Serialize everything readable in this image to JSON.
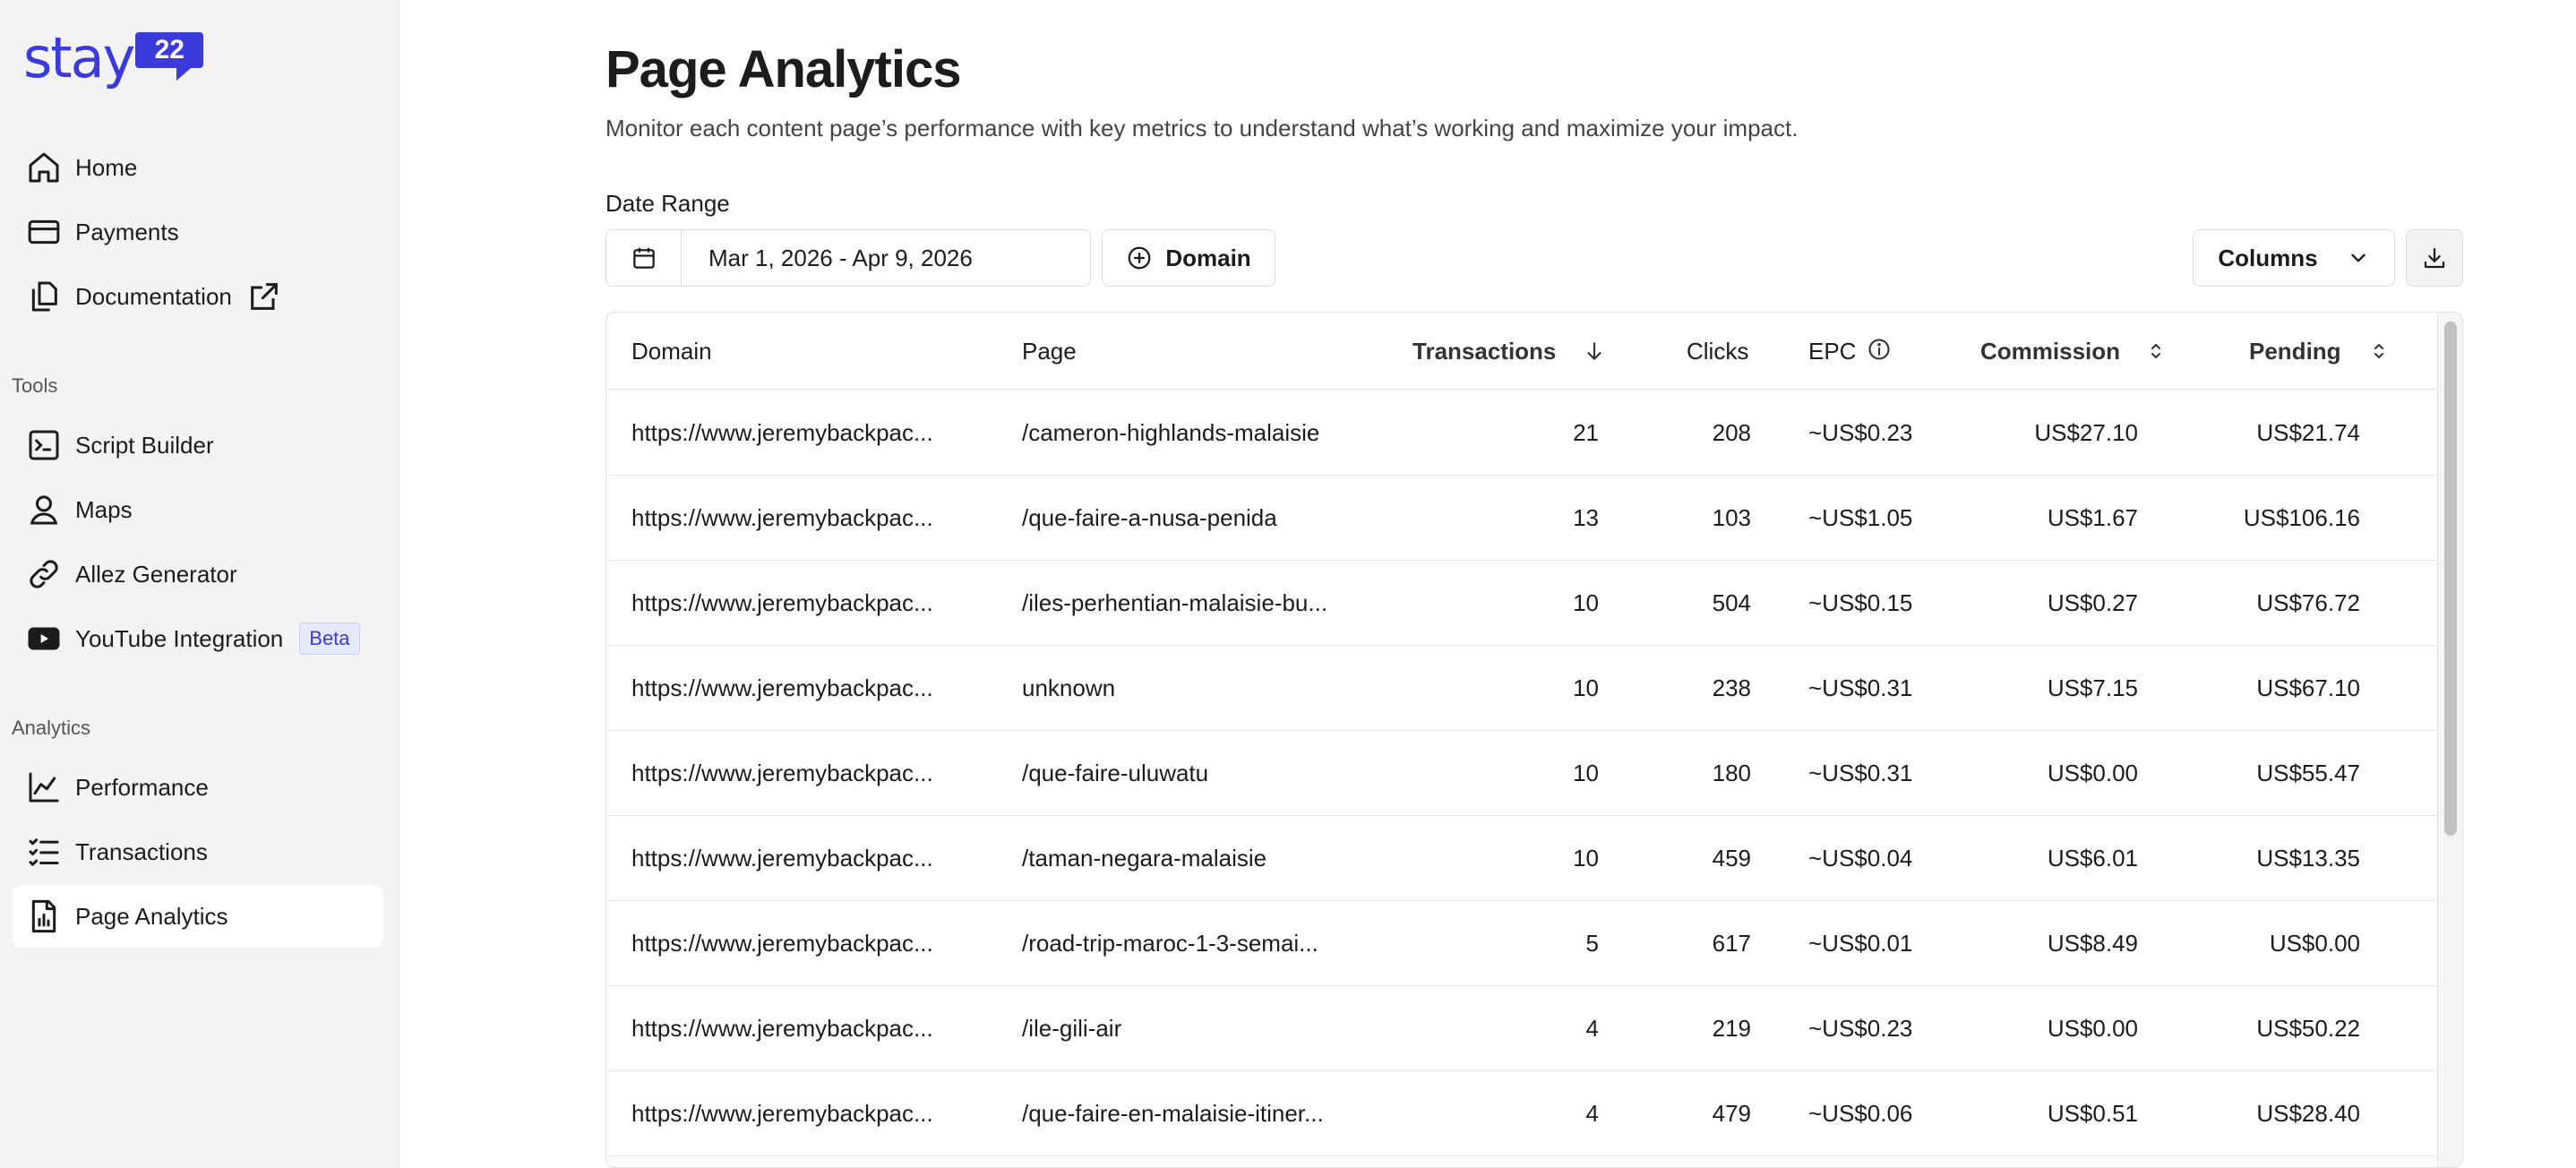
{
  "brand": {
    "name": "stay",
    "badge": "22",
    "color": "#3b3bdc"
  },
  "nav": {
    "main": [
      {
        "label": "Home",
        "icon": "home-icon"
      },
      {
        "label": "Payments",
        "icon": "credit-card-icon"
      },
      {
        "label": "Documentation",
        "icon": "copy-icon",
        "external": true
      }
    ],
    "tools_label": "Tools",
    "tools": [
      {
        "label": "Script Builder",
        "icon": "terminal-icon"
      },
      {
        "label": "Maps",
        "icon": "map-pin-icon"
      },
      {
        "label": "Allez Generator",
        "icon": "link-icon"
      },
      {
        "label": "YouTube Integration",
        "icon": "youtube-icon",
        "badge": "Beta"
      }
    ],
    "analytics_label": "Analytics",
    "analytics": [
      {
        "label": "Performance",
        "icon": "line-chart-icon"
      },
      {
        "label": "Transactions",
        "icon": "checklist-icon"
      },
      {
        "label": "Page Analytics",
        "icon": "file-chart-icon",
        "active": true
      }
    ]
  },
  "page": {
    "title": "Page Analytics",
    "subtitle": "Monitor each content page’s performance with key metrics to understand what’s working and maximize your impact.",
    "date_range_label": "Date Range",
    "date_range_value": "Mar 1, 2026 - Apr 9, 2026",
    "domain_button": "Domain",
    "columns_button": "Columns"
  },
  "table": {
    "headers": {
      "domain": "Domain",
      "page": "Page",
      "transactions": "Transactions",
      "clicks": "Clicks",
      "epc": "EPC",
      "commission": "Commission",
      "pending": "Pending"
    },
    "rows": [
      {
        "domain": "https://www.jeremybackpac...",
        "page": "/cameron-highlands-malaisie",
        "transactions": "21",
        "clicks": "208",
        "epc": "~US$0.23",
        "commission": "US$27.10",
        "pending": "US$21.74"
      },
      {
        "domain": "https://www.jeremybackpac...",
        "page": "/que-faire-a-nusa-penida",
        "transactions": "13",
        "clicks": "103",
        "epc": "~US$1.05",
        "commission": "US$1.67",
        "pending": "US$106.16"
      },
      {
        "domain": "https://www.jeremybackpac...",
        "page": "/iles-perhentian-malaisie-bu...",
        "transactions": "10",
        "clicks": "504",
        "epc": "~US$0.15",
        "commission": "US$0.27",
        "pending": "US$76.72"
      },
      {
        "domain": "https://www.jeremybackpac...",
        "page": "unknown",
        "transactions": "10",
        "clicks": "238",
        "epc": "~US$0.31",
        "commission": "US$7.15",
        "pending": "US$67.10"
      },
      {
        "domain": "https://www.jeremybackpac...",
        "page": "/que-faire-uluwatu",
        "transactions": "10",
        "clicks": "180",
        "epc": "~US$0.31",
        "commission": "US$0.00",
        "pending": "US$55.47"
      },
      {
        "domain": "https://www.jeremybackpac...",
        "page": "/taman-negara-malaisie",
        "transactions": "10",
        "clicks": "459",
        "epc": "~US$0.04",
        "commission": "US$6.01",
        "pending": "US$13.35"
      },
      {
        "domain": "https://www.jeremybackpac...",
        "page": "/road-trip-maroc-1-3-semai...",
        "transactions": "5",
        "clicks": "617",
        "epc": "~US$0.01",
        "commission": "US$8.49",
        "pending": "US$0.00"
      },
      {
        "domain": "https://www.jeremybackpac...",
        "page": "/ile-gili-air",
        "transactions": "4",
        "clicks": "219",
        "epc": "~US$0.23",
        "commission": "US$0.00",
        "pending": "US$50.22"
      },
      {
        "domain": "https://www.jeremybackpac...",
        "page": "/que-faire-en-malaisie-itiner...",
        "transactions": "4",
        "clicks": "479",
        "epc": "~US$0.06",
        "commission": "US$0.51",
        "pending": "US$28.40"
      }
    ]
  }
}
